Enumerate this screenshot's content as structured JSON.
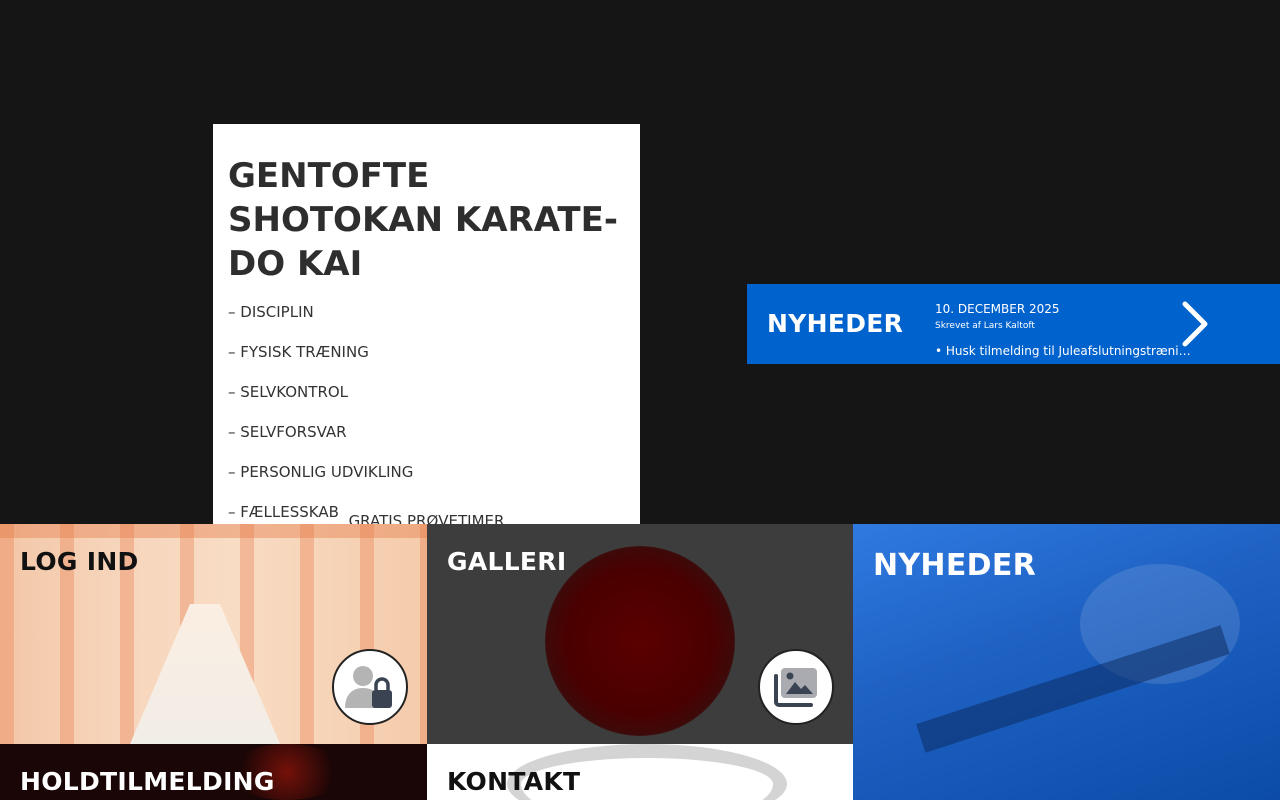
{
  "intro": {
    "title": "GENTOFTE SHOTOKAN KARATE-DO KAI",
    "values": [
      "– DISCIPLIN",
      "– FYSISK TRÆNING",
      "– SELVKONTROL",
      "– SELVFORSVAR",
      "– PERSONLIG UDVIKLING",
      "– FÆLLESSKAB"
    ],
    "trial_link": "GRATIS PRØVETIMER"
  },
  "news_banner": {
    "title": "NYHEDER",
    "date": "10. DECEMBER 2025",
    "author": "Skrevet af Lars Kaltoft",
    "headline": "• Husk tilmelding til Juleafslutningstræning…",
    "next_icon": "chevron-right-icon"
  },
  "tiles": {
    "login": {
      "title": "LOG IND",
      "icon": "user-lock-icon"
    },
    "gallery": {
      "title": "GALLERI",
      "icon": "images-icon"
    },
    "news": {
      "title": "NYHEDER"
    },
    "signup": {
      "title": "HOLDTILMELDING"
    },
    "contact": {
      "title": "KONTAKT"
    }
  },
  "colors": {
    "background": "#151515",
    "news_blue": "#0062cc",
    "card_white": "#ffffff"
  }
}
